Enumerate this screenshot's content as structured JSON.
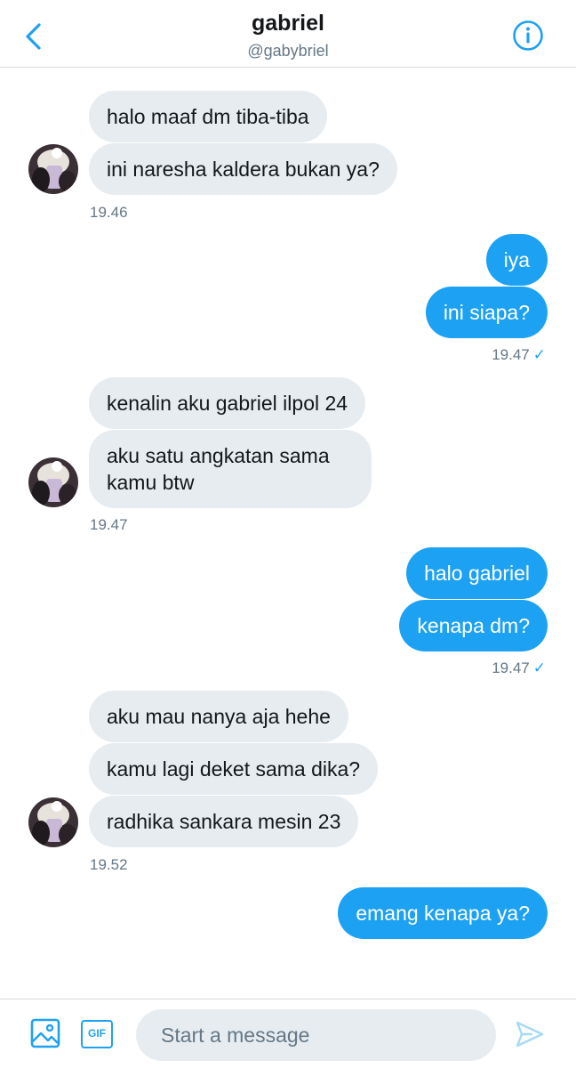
{
  "header": {
    "name": "gabriel",
    "handle": "@gabybriel",
    "back_icon": "chevron-left-icon",
    "info_icon": "info-icon"
  },
  "messages": [
    {
      "direction": "in",
      "text": "halo maaf dm tiba-tiba"
    },
    {
      "direction": "in",
      "text": "ini naresha kaldera bukan ya?"
    },
    {
      "direction": "out",
      "text": "iya"
    },
    {
      "direction": "out",
      "text": "ini siapa?"
    },
    {
      "direction": "in",
      "text": "kenalin aku gabriel ilpol 24"
    },
    {
      "direction": "in",
      "text": "aku satu angkatan sama kamu btw"
    },
    {
      "direction": "out",
      "text": "halo gabriel"
    },
    {
      "direction": "out",
      "text": "kenapa dm?"
    },
    {
      "direction": "in",
      "text": "aku mau nanya aja hehe"
    },
    {
      "direction": "in",
      "text": "kamu lagi deket sama dika?"
    },
    {
      "direction": "in",
      "text": "radhika sankara mesin 23"
    },
    {
      "direction": "out",
      "text": "emang kenapa ya?"
    }
  ],
  "timestamps": [
    {
      "direction": "in",
      "time": "19.46"
    },
    {
      "direction": "out",
      "time": "19.47",
      "check": "✓"
    },
    {
      "direction": "in",
      "time": "19.47"
    },
    {
      "direction": "out",
      "time": "19.47",
      "check": "✓"
    },
    {
      "direction": "in",
      "time": "19.52"
    }
  ],
  "composer": {
    "placeholder": "Start a message",
    "value": "",
    "gif_label": "GIF",
    "media_icon": "image-icon",
    "send_icon": "send-icon"
  },
  "colors": {
    "accent": "#1da1f2",
    "incoming_bubble": "#e6ecf0",
    "secondary_text": "#657786"
  }
}
